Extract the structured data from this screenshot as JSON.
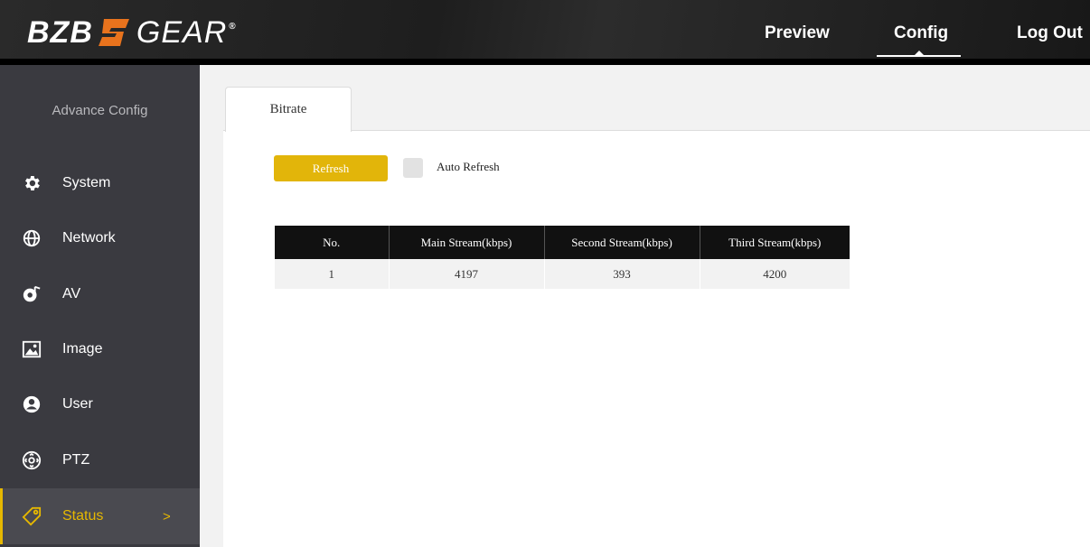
{
  "header": {
    "logo_left": "BZB",
    "logo_right": "GEAR",
    "logo_reg": "®",
    "nav": [
      {
        "label": "Preview"
      },
      {
        "label": "Config"
      },
      {
        "label": "Log Out"
      }
    ],
    "accent_color": "#e6b800"
  },
  "sidebar": {
    "title": "Advance Config",
    "items": [
      {
        "label": "System",
        "icon": "gear-icon"
      },
      {
        "label": "Network",
        "icon": "globe-icon"
      },
      {
        "label": "AV",
        "icon": "av-music-icon"
      },
      {
        "label": "Image",
        "icon": "image-icon"
      },
      {
        "label": "User",
        "icon": "user-icon"
      },
      {
        "label": "PTZ",
        "icon": "ptz-icon"
      },
      {
        "label": "Status",
        "icon": "tag-icon",
        "arrow": ">"
      }
    ]
  },
  "main": {
    "tabs": [
      {
        "label": "Bitrate"
      }
    ],
    "refresh_label": "Refresh",
    "auto_refresh_label": "Auto Refresh",
    "table": {
      "headers": [
        "No.",
        "Main Stream(kbps)",
        "Second Stream(kbps)",
        "Third Stream(kbps)"
      ],
      "rows": [
        [
          "1",
          "4197",
          "393",
          "4200"
        ]
      ]
    }
  }
}
